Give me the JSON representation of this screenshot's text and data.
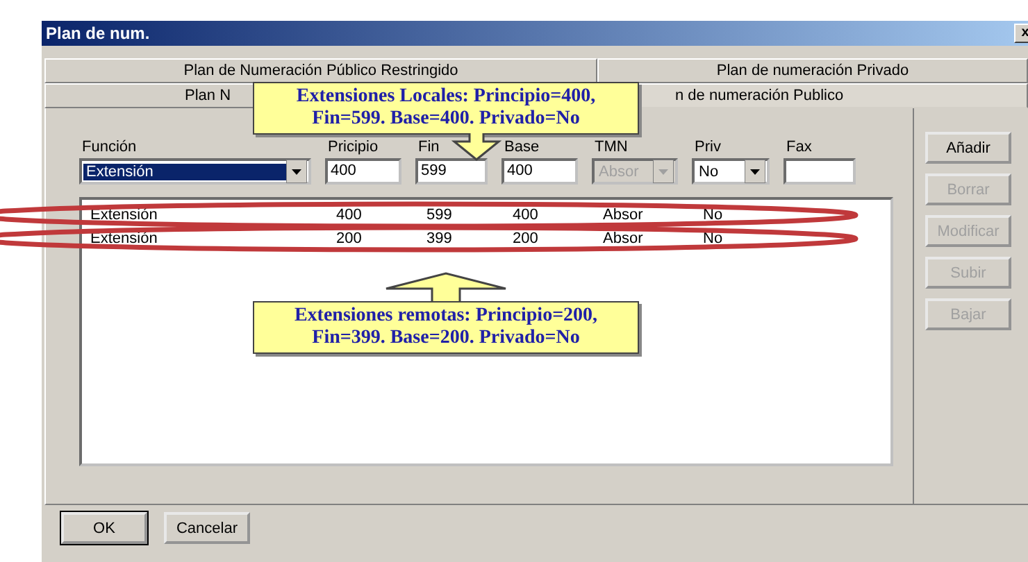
{
  "window": {
    "title": "Plan de num.",
    "close": "x"
  },
  "tabs": [
    {
      "label": "Plan de Numeración Público Restringido",
      "selected": false
    },
    {
      "label": "Plan de numeración Privado",
      "selected": false
    },
    {
      "label": "Plan N",
      "selected": false
    },
    {
      "label": "n de numeración Publico",
      "selected": true
    }
  ],
  "fields": [
    {
      "kind": "combo",
      "label": "Función",
      "value": "Extensión",
      "highlighted": true,
      "disabled": false
    },
    {
      "kind": "text",
      "label": "Pricipio",
      "value": "400"
    },
    {
      "kind": "text",
      "label": "Fin",
      "value": "599"
    },
    {
      "kind": "text",
      "label": "Base",
      "value": "400"
    },
    {
      "kind": "combo",
      "label": "TMN",
      "value": "Absor",
      "highlighted": false,
      "disabled": true
    },
    {
      "kind": "combo",
      "label": "Priv",
      "value": "No",
      "highlighted": false,
      "disabled": false
    },
    {
      "kind": "text",
      "label": "Fax"
    }
  ],
  "rows": [
    {
      "cells": [
        "Extensión",
        "400",
        "599",
        "400",
        "Absor",
        "No"
      ],
      "circled": true
    },
    {
      "cells": [
        "Extensión",
        "200",
        "399",
        "200",
        "Absor",
        "No"
      ],
      "circled": true
    }
  ],
  "side_buttons": [
    {
      "label": "Añadir",
      "disabled": false
    },
    {
      "label": "Borrar",
      "disabled": true
    },
    {
      "label": "Modificar",
      "disabled": true
    },
    {
      "label": "Subir",
      "disabled": true
    },
    {
      "label": "Bajar",
      "disabled": true
    }
  ],
  "buttons": [
    {
      "label": "OK",
      "default": true
    },
    {
      "label": "Cancelar",
      "default": false
    }
  ],
  "callouts": [
    {
      "text": "Extensiones Locales: Principio=400, Fin=599. Base=400. Privado=No",
      "kind": "down"
    },
    {
      "text": "Extensiones remotas: Principio=200, Fin=399. Base=200. Privado=No",
      "kind": "up"
    }
  ]
}
